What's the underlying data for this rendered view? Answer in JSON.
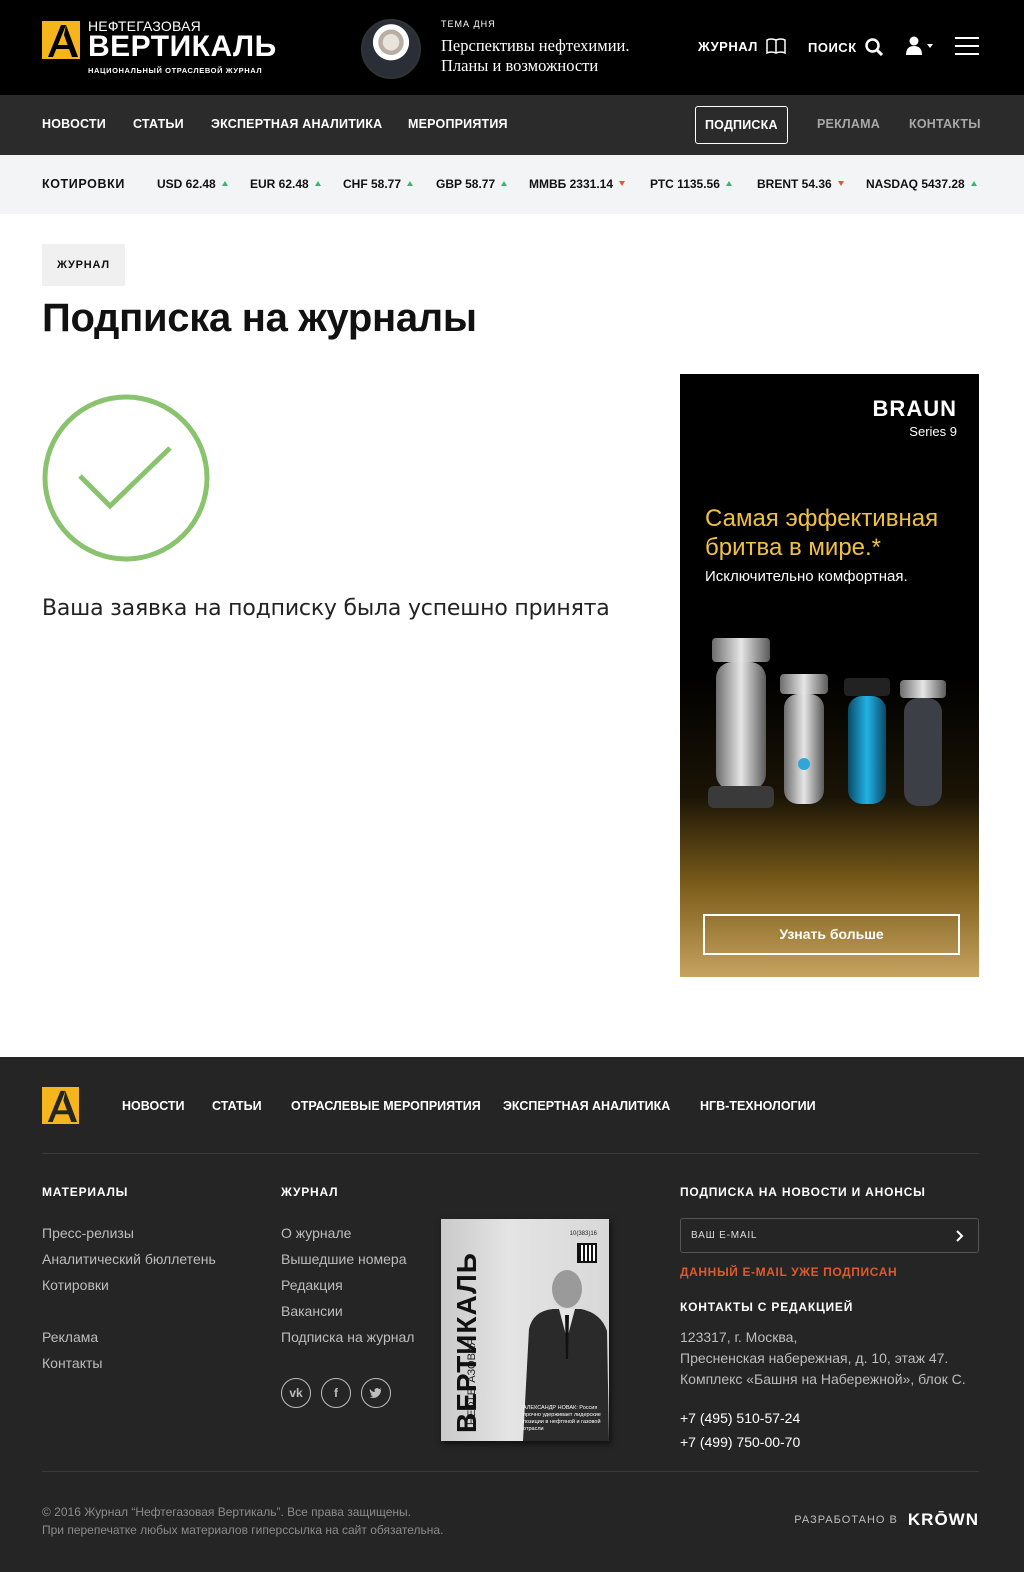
{
  "header": {
    "logo": {
      "top": "НЕФТЕГАЗОВАЯ",
      "main": "ВЕРТИКАЛЬ",
      "sub": "НАЦИОНАЛЬНЫЙ ОТРАСЛЕВОЙ ЖУРНАЛ"
    },
    "topic_label": "ТЕМА ДНЯ",
    "topic_title": "Перспективы нефтехимии. Планы и возможности",
    "journal_label": "ЖУРНАЛ",
    "search_label": "ПОИСК"
  },
  "nav": {
    "items": [
      "НОВОСТИ",
      "СТАТЬИ",
      "ЭКСПЕРТНАЯ АНАЛИТИКА",
      "МЕРОПРИЯТИЯ"
    ],
    "subscribe": "ПОДПИСКА",
    "ads": "РЕКЛАМА",
    "contacts": "КОНТАКТЫ"
  },
  "quotes": {
    "label": "КОТИРОВКИ",
    "items": [
      {
        "text": "USD 62.48",
        "trend": "up"
      },
      {
        "text": "EUR 62.48",
        "trend": "up"
      },
      {
        "text": "CHF 58.77",
        "trend": "up"
      },
      {
        "text": "GBP 58.77",
        "trend": "up"
      },
      {
        "text": "ММВБ 2331.14",
        "trend": "down"
      },
      {
        "text": "РТС 1135.56",
        "trend": "up"
      },
      {
        "text": "BRENT 54.36",
        "trend": "down"
      },
      {
        "text": "NASDAQ 5437.28",
        "trend": "up"
      }
    ]
  },
  "main": {
    "tag": "ЖУРНАЛ",
    "title": "Подписка на журналы",
    "success_message": "Ваша заявка на подписку была успешно принята",
    "success_color": "#8ac36e"
  },
  "ad": {
    "brand": "BRAUN",
    "series": "Series 9",
    "headline": "Самая эффективная бритва в мире.*",
    "sub": "Исключительно комфортная.",
    "cta": "Узнать больше"
  },
  "footer": {
    "nav": [
      "НОВОСТИ",
      "СТАТЬИ",
      "ОТРАСЛЕВЫЕ МЕРОПРИЯТИЯ",
      "ЭКСПЕРТНАЯ АНАЛИТИКА",
      "НГВ-ТЕХНОЛОГИИ"
    ],
    "materials": {
      "heading": "МАТЕРИАЛЫ",
      "items": [
        "Пресс-релизы",
        "Аналитический бюллетень",
        "Котировки"
      ],
      "items2": [
        "Реклама",
        "Контакты"
      ]
    },
    "journal": {
      "heading": "ЖУРНАЛ",
      "items": [
        "О журнале",
        "Вышедшие номера",
        "Редакция",
        "Вакансии",
        "Подписка на журнал"
      ]
    },
    "social": [
      "vk",
      "f",
      "twitter"
    ],
    "magazine": {
      "title_small": "НЕФТЕГАЗОВАЯ",
      "title": "ВЕРТИКАЛЬ",
      "issue": "10(383)16",
      "caption": "АЛЕКСАНДР НОВАК: Россия прочно удерживает лидерские позиции в нефтяной и газовой отрасли"
    },
    "newsletter": {
      "heading": "ПОДПИСКА НА НОВОСТИ И АНОНСЫ",
      "placeholder": "ВАШ E-MAIL",
      "status": "ДАННЫЙ E-MAIL УЖЕ ПОДПИСАН"
    },
    "contacts": {
      "heading": "КОНТАКТЫ С РЕДАКЦИЕЙ",
      "address_1": "123317, г. Москва,",
      "address_2": "Пресненская набережная, д. 10, этаж 47.",
      "address_3": "Комплекс «Башня на Набережной», блок С.",
      "phone_1": "+7 (495) 510-57-24",
      "phone_2": "+7 (499) 750-00-70"
    },
    "copyright_1": "© 2016 Журнал “Нефтегазовая Вертикаль”. Все права защищены.",
    "copyright_2": "При перепечатке любых материалов гиперссылка на сайт обязательна.",
    "dev_label": "РАЗРАБОТАНО В",
    "dev_brand": "KRŌWN"
  }
}
